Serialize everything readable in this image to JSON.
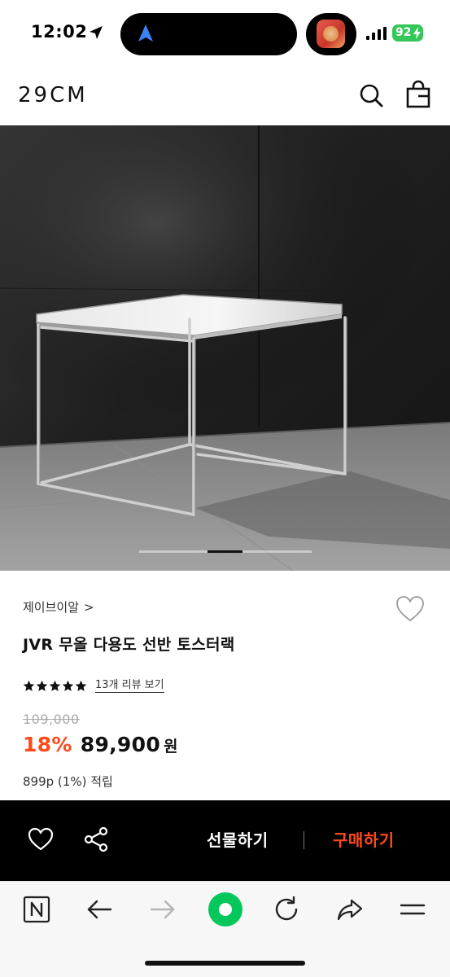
{
  "status_bar": {
    "time": "12:02",
    "battery": "92"
  },
  "header": {
    "logo": "29CM"
  },
  "product": {
    "brand": "제이브이알",
    "brand_chevron": ">",
    "title": "JVR 무올 다용도 선반 토스터랙",
    "rating_stars": 5,
    "review_link": "13개 리뷰 보기",
    "original_price": "109,000",
    "discount": "18%",
    "sale_price": "89,900",
    "currency": "원",
    "points": "899p (1%) 적립"
  },
  "carousel": {
    "current_index": 2,
    "total": 5
  },
  "action_bar": {
    "gift_label": "선물하기",
    "separator": "|",
    "buy_label": "구매하기"
  },
  "colors": {
    "accent": "#ff4a1c",
    "action_bar_bg": "#000000",
    "battery": "#34c759",
    "home_button": "#03c75a"
  },
  "icons": {
    "location": "location-arrow-icon",
    "search": "search-icon",
    "bag": "shopping-bag-icon",
    "wishlist": "heart-outline-icon",
    "share": "share-icon",
    "star": "star-icon",
    "tab_n": "n-tab-icon",
    "back": "arrow-left-icon",
    "forward": "arrow-right-icon",
    "home": "naver-green-dot-icon",
    "reload": "reload-icon",
    "browser_share": "forward-share-icon",
    "menu": "hamburger-menu-icon"
  }
}
